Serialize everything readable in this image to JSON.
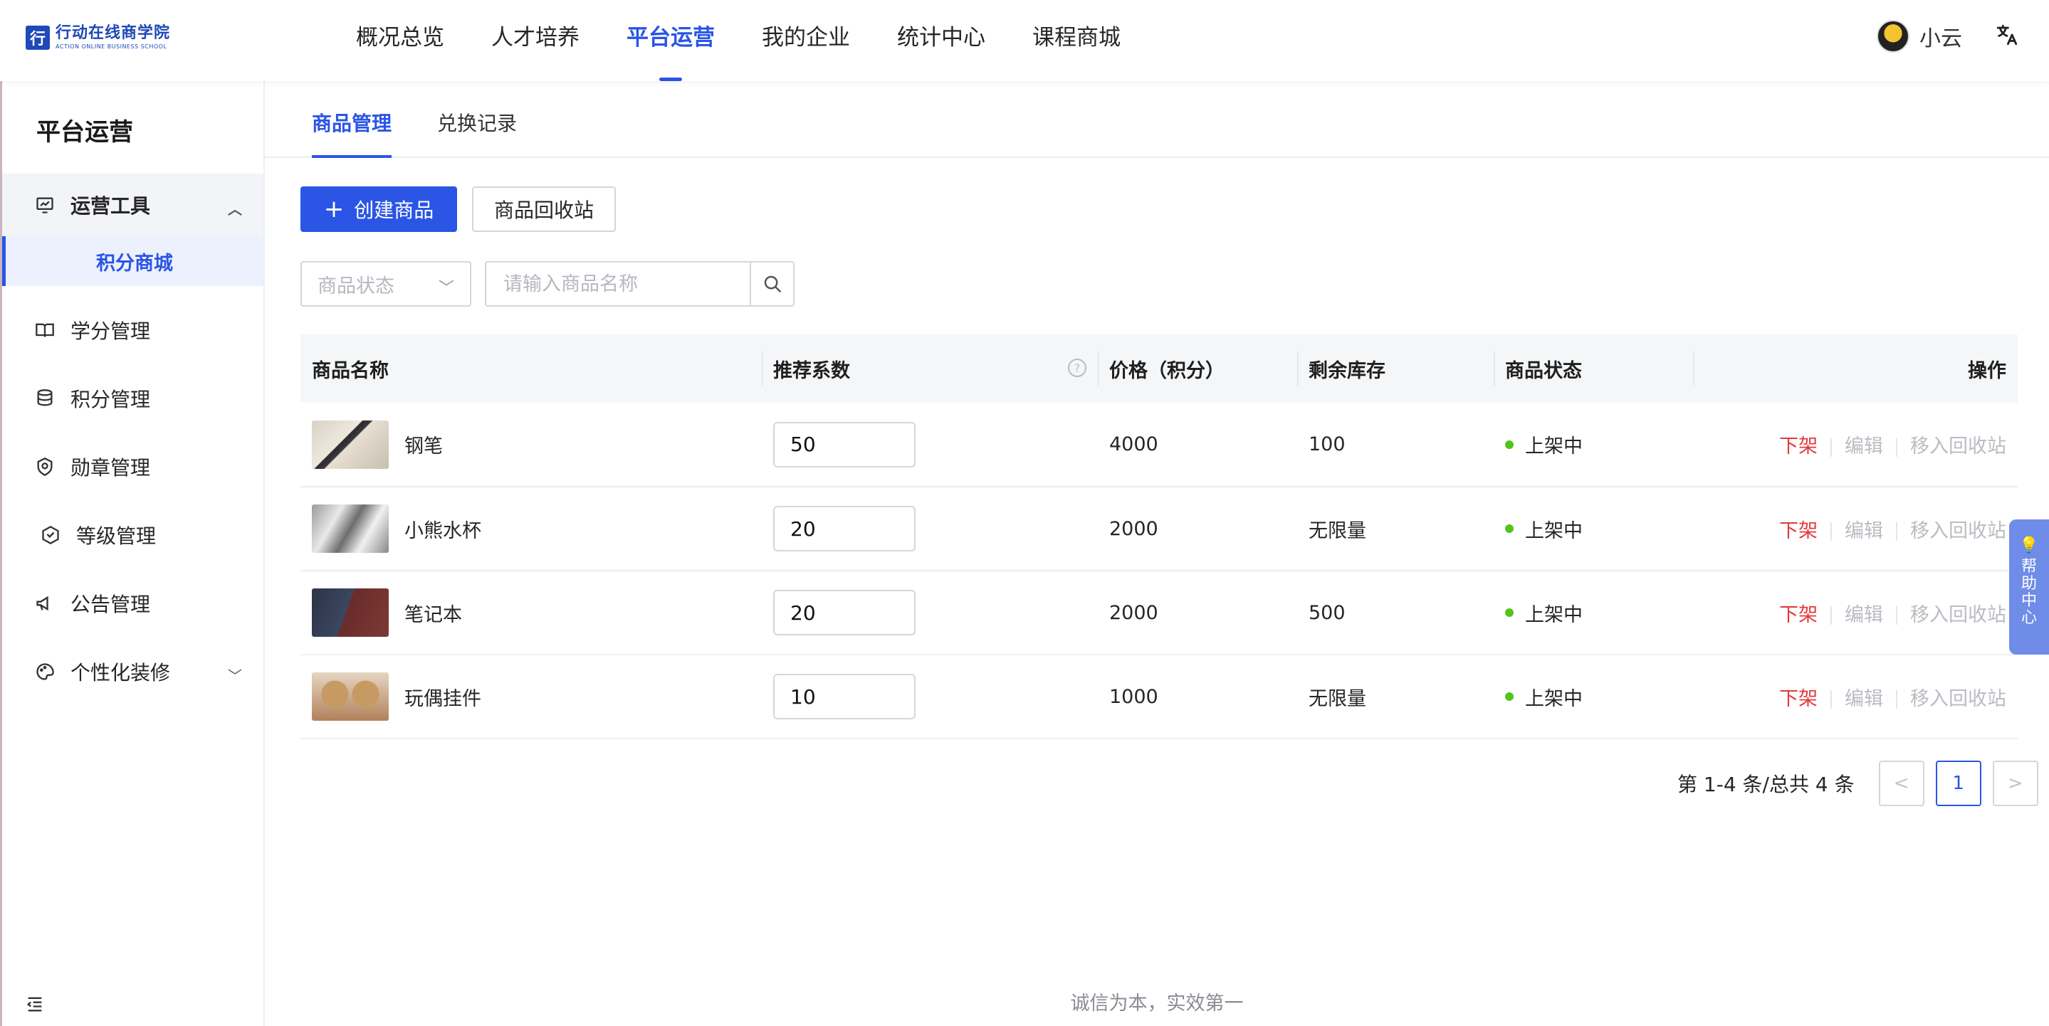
{
  "logo": {
    "cn": "行动在线商学院",
    "en": "ACTION ONLINE BUSINESS SCHOOL"
  },
  "nav": [
    {
      "label": "概况总览"
    },
    {
      "label": "人才培养"
    },
    {
      "label": "平台运营"
    },
    {
      "label": "我的企业"
    },
    {
      "label": "统计中心"
    },
    {
      "label": "课程商城"
    }
  ],
  "nav_active": "平台运营",
  "user": {
    "name": "小云"
  },
  "lang_icon": "文A",
  "sidebar": {
    "title": "平台运营",
    "menu": [
      {
        "label": "运营工具",
        "icon": "chart-monitor-icon"
      },
      {
        "label": "积分商城"
      },
      {
        "label": "学分管理",
        "icon": "book-icon"
      },
      {
        "label": "积分管理",
        "icon": "coin-stack-icon"
      },
      {
        "label": "勋章管理",
        "icon": "medal-icon"
      },
      {
        "label": "等级管理",
        "icon": "level-shield-icon"
      },
      {
        "label": "公告管理",
        "icon": "megaphone-icon"
      },
      {
        "label": "个性化装修",
        "icon": "palette-icon"
      }
    ]
  },
  "tabs": [
    {
      "label": "商品管理"
    },
    {
      "label": "兑换记录"
    }
  ],
  "toolbar": {
    "create_label": "创建商品",
    "recycle_label": "商品回收站"
  },
  "filters": {
    "status_placeholder": "商品状态",
    "search_placeholder": "请输入商品名称"
  },
  "table": {
    "columns": [
      "商品名称",
      "推荐系数",
      "价格（积分）",
      "剩余库存",
      "商品状态",
      "操作"
    ],
    "rows": [
      {
        "name": "钢笔",
        "coef": "50",
        "price": "4000",
        "stock": "100",
        "status": "上架中"
      },
      {
        "name": "小熊水杯",
        "coef": "20",
        "price": "2000",
        "stock": "无限量",
        "status": "上架中"
      },
      {
        "name": "笔记本",
        "coef": "20",
        "price": "2000",
        "stock": "500",
        "status": "上架中"
      },
      {
        "name": "玩偶挂件",
        "coef": "10",
        "price": "1000",
        "stock": "无限量",
        "status": "上架中"
      }
    ],
    "ops": {
      "off": "下架",
      "edit": "编辑",
      "recycle": "移入回收站"
    }
  },
  "pagination": {
    "info": "第 1-4 条/总共 4 条",
    "current": "1",
    "prev": "<",
    "next": ">"
  },
  "footer": "诚信为本，实效第一",
  "help": {
    "label": "帮助中心"
  },
  "colors": {
    "primary": "#2a55e5",
    "danger": "#e4393c",
    "success": "#52c41a"
  }
}
